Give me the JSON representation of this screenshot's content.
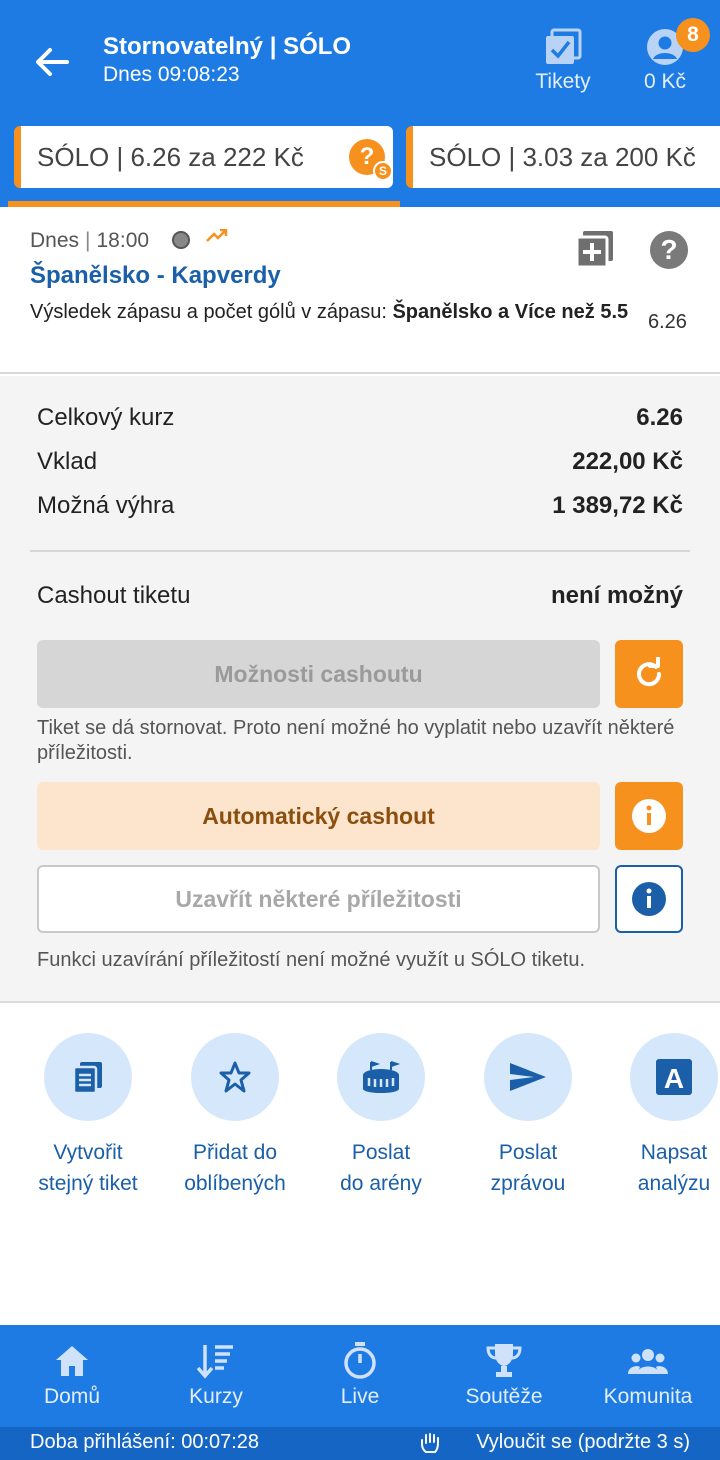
{
  "header": {
    "title": "Stornovatelný | SÓLO",
    "subtitle": "Dnes 09:08:23",
    "tickets_label": "Tikety",
    "balance": "0 Kč",
    "notification_count": "8"
  },
  "ticket_tabs": [
    {
      "label": "SÓLO  | 6.26 za 222 Kč"
    },
    {
      "label": "SÓLO  | 3.03 za 200 Kč"
    }
  ],
  "event": {
    "day": "Dnes",
    "time": "18:00",
    "name": "Španělsko - Kapverdy",
    "market": "Výsledek zápasu a počet gólů v zápasu: ",
    "selection": "Španělsko a Více než 5.5",
    "odds": "6.26"
  },
  "summary": {
    "total_odds_label": "Celkový kurz",
    "total_odds": "6.26",
    "stake_label": "Vklad",
    "stake": "222,00 Kč",
    "win_label": "Možná výhra",
    "win": "1 389,72 Kč",
    "cashout_label": "Cashout tiketu",
    "cashout_status": "není možný",
    "cashout_options": "Možnosti cashoutu",
    "cashout_note": "Tiket se dá stornovat. Proto není možné ho vyplatit nebo uzavřít některé příležitosti.",
    "auto_cashout": "Automatický cashout",
    "close_opportunities": "Uzavřít některé příležitosti",
    "close_note": "Funkci uzavírání příležitostí není možné využít u SÓLO tiketu."
  },
  "actions": [
    {
      "label1": "Vytvořit",
      "label2": "stejný tiket",
      "icon": "copy-ticket-icon"
    },
    {
      "label1": "Přidat do",
      "label2": "oblíbených",
      "icon": "star-icon"
    },
    {
      "label1": "Poslat",
      "label2": "do arény",
      "icon": "arena-icon"
    },
    {
      "label1": "Poslat",
      "label2": "zprávou",
      "icon": "send-icon"
    },
    {
      "label1": "Napsat",
      "label2": "analýzu",
      "icon": "analysis-icon"
    }
  ],
  "nav": [
    {
      "label": "Domů",
      "icon": "home-icon"
    },
    {
      "label": "Kurzy",
      "icon": "odds-icon"
    },
    {
      "label": "Live",
      "icon": "stopwatch-icon"
    },
    {
      "label": "Soutěže",
      "icon": "trophy-icon"
    },
    {
      "label": "Komunita",
      "icon": "community-icon"
    }
  ],
  "status": {
    "login_time": "Doba přihlášení: 00:07:28",
    "exclude": "Vyloučit se (podržte 3 s)"
  },
  "colors": {
    "brand_blue": "#1e7be3",
    "accent_orange": "#f7911d",
    "link_blue": "#1a5fa8"
  }
}
